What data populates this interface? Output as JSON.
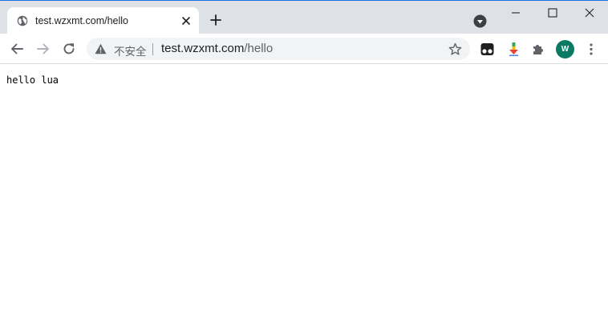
{
  "tab": {
    "title": "test.wzxmt.com/hello",
    "favicon": "globe-icon"
  },
  "omnibox": {
    "security_label": "不安全",
    "url_host": "test.wzxmt.com",
    "url_path": "/hello"
  },
  "profile": {
    "initial": "W",
    "color": "#0b7a63"
  },
  "colors": {
    "frame": "#dee1e6",
    "accent": "#1a73e8"
  },
  "page": {
    "text": "hello lua"
  }
}
